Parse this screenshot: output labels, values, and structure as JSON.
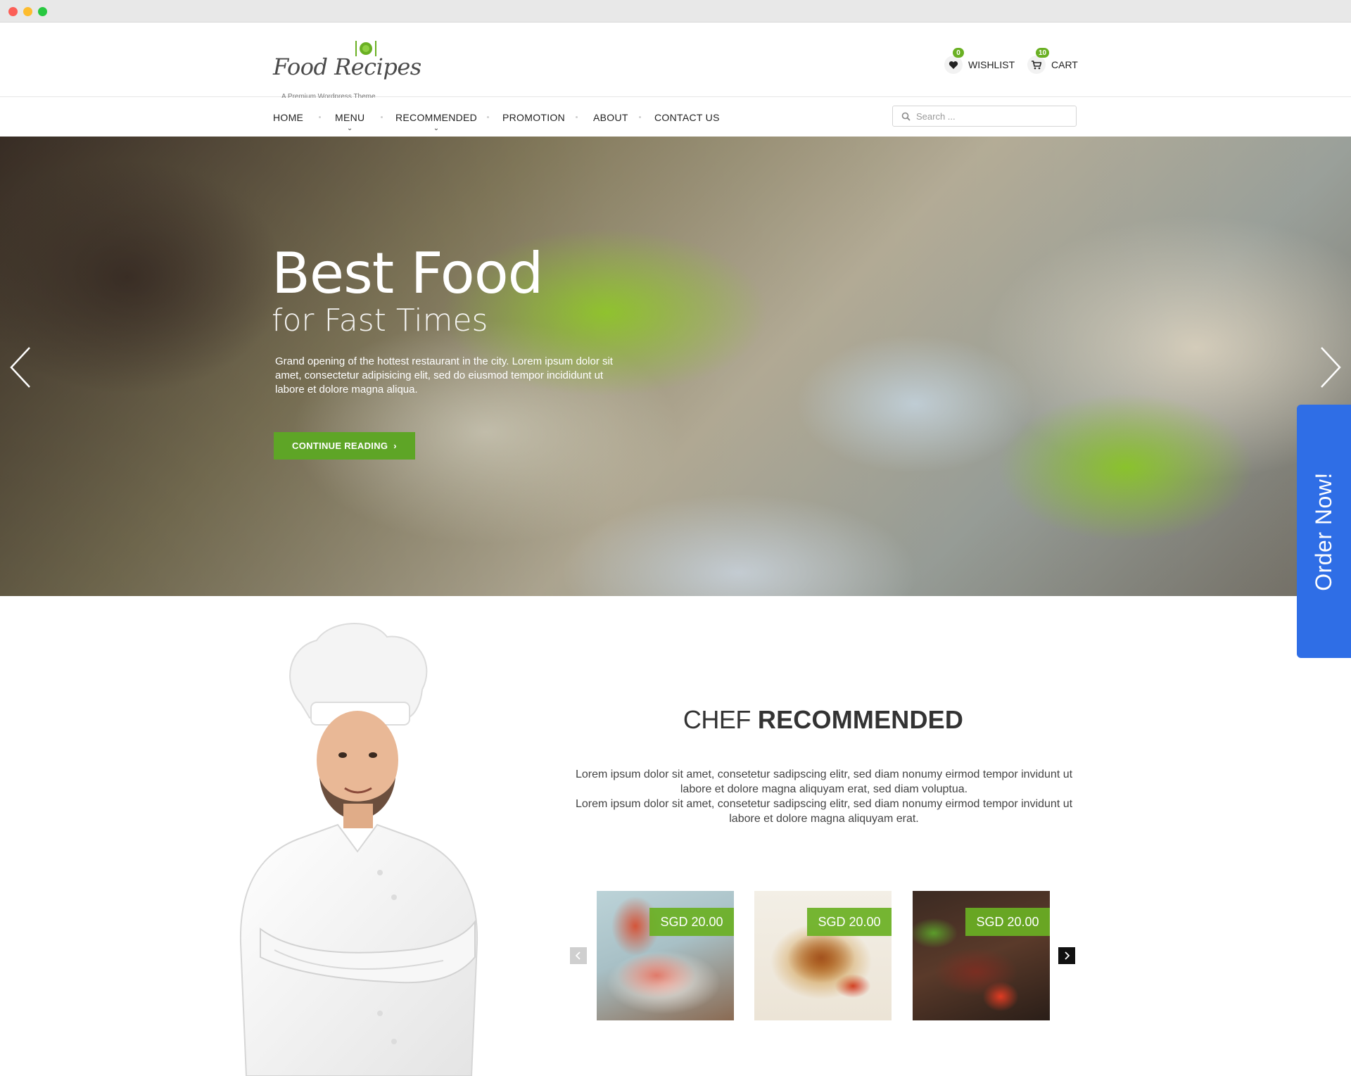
{
  "logo": {
    "title": "Food Recipes",
    "tagline": "A Premium Wordpress Theme"
  },
  "header": {
    "wishlist": {
      "label": "WISHLIST",
      "count": "0"
    },
    "cart": {
      "label": "CART",
      "count": "10"
    }
  },
  "nav": {
    "items": [
      {
        "label": "HOME"
      },
      {
        "label": "MENU"
      },
      {
        "label": "RECOMMENDED"
      },
      {
        "label": "PROMOTION"
      },
      {
        "label": "ABOUT"
      },
      {
        "label": "CONTACT US"
      }
    ],
    "search_placeholder": "Search ..."
  },
  "hero": {
    "title": "Best Food",
    "subtitle": "for Fast Times",
    "text": "Grand opening of the hottest restaurant in the city. Lorem ipsum dolor sit amet, consectetur adipisicing elit, sed do eiusmod tempor incididunt ut labore et dolore magna aliqua.",
    "button_label": "CONTINUE READING"
  },
  "order_now": "Order Now!",
  "section": {
    "title_light": "CHEF",
    "title_bold": "RECOMMENDED",
    "paragraph_1": "Lorem ipsum dolor sit amet, consetetur sadipscing elitr, sed diam nonumy eirmod tempor invidunt ut labore et dolore magna aliquyam erat, sed diam voluptua.",
    "paragraph_2": "Lorem ipsum dolor sit amet, consetetur sadipscing elitr, sed diam nonumy eirmod tempor invidunt ut labore et dolore magna aliquyam erat."
  },
  "dishes": [
    {
      "price": "SGD 20.00"
    },
    {
      "price": "SGD 20.00"
    },
    {
      "price": "SGD 20.00"
    }
  ],
  "colors": {
    "accent_green": "#5ea526",
    "order_blue": "#2f6ee6"
  }
}
